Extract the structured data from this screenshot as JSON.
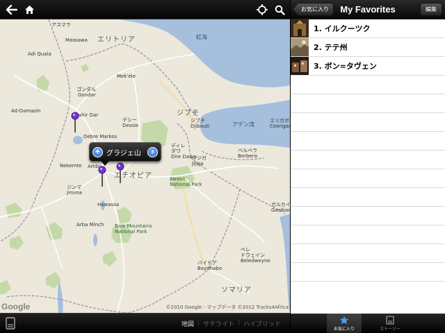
{
  "toolbar": {
    "back_icon": "arrow-left-icon",
    "home_icon": "home-icon",
    "locate_icon": "crosshair-icon",
    "search_icon": "search-icon"
  },
  "map": {
    "places": {
      "asmara": "アスマラ",
      "massawa": "Massawa",
      "eritrea": "エリトリア",
      "adi_quala": "Adi Quala",
      "mek_ele": "Mek'ele",
      "gondar": "ゴンダル",
      "gondar_en": "Gondar",
      "bahir_dar": "Bahir Dar",
      "debre_markos": "Debre Markos",
      "dessie": "デシー\nDessie",
      "djibouti": "ジブチ",
      "djibouti_city": "ジブチ\nDjibouti",
      "dire_dawa": "ディレ\nダワ\nDire Dawa",
      "addis": "Ambo",
      "nekemte": "Nekemte",
      "jimma": "ジンマ\nJimma",
      "hawassa": "Hawassa",
      "arba_minch": "Arba Minch",
      "ethiopia": "エチオピア",
      "hargeysa": "ジジガ\nJijiga",
      "berbera": "ベルベラ\nBerbera",
      "somalia": "ソマリア",
      "ad_damazin": "Ad-Damazin",
      "yemen": "エリガボ\nCeerigaabo",
      "galkayo": "ガルカイヨ\nGaalkacyo",
      "beledweyne": "ベレ\nドウェイン\nBeledweyne",
      "baydhabo": "バイドア\nBaydhabo",
      "bale": "Bale Mountains\nNational Park",
      "awash": "Awash\nNational Park",
      "gulf": "アデン湾",
      "red_sea": "紅海"
    },
    "callout_title": "グラジェ山",
    "callout_add_icon": "plus-icon",
    "callout_detail_icon": "chevron-right-icon",
    "google": "Google",
    "copyright": "©2010 Google - マップデータ ©2012 Tracks4Africa"
  },
  "mapbar": {
    "left_icon": "page-curl-icon",
    "types": [
      "地図",
      "サテライト",
      "ハイブリッド"
    ],
    "selected": "地図"
  },
  "panel": {
    "back_label": "お気に入り",
    "title": "My Favorites",
    "edit_label": "編集",
    "items": [
      {
        "label": "1. イルクーツク",
        "thumb": "church-photo"
      },
      {
        "label": "2. テテ州",
        "thumb": "landscape-photo"
      },
      {
        "label": "3. ボン=タヴェン",
        "thumb": "town-photo"
      }
    ]
  },
  "tabs": [
    {
      "label": "お気に入り",
      "icon": "star-icon",
      "active": true
    },
    {
      "label": "ストーリー",
      "icon": "book-icon",
      "active": false
    }
  ],
  "colors": {
    "map_land": "#ece8dc",
    "map_water": "#a5bfdd",
    "park": "#c5d8a8",
    "pin": "#7b2fd2"
  }
}
